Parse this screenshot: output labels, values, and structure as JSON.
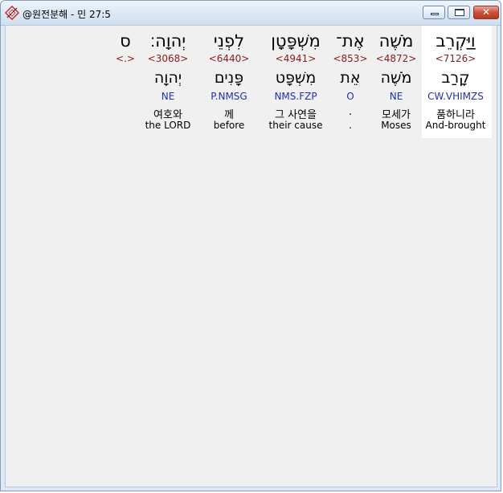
{
  "window": {
    "title": "@원전분해 - 민 27:5"
  },
  "words": [
    {
      "hebrew": "וַיַּקְרֵב",
      "strong": "<7126>",
      "lemma": "קָרַב",
      "morph": "CW.VHIMZS",
      "korean": "품하니라",
      "english": "And-brought"
    },
    {
      "hebrew": "מֹשֶׁה",
      "strong": "<4872>",
      "lemma": "מֹשֶׁה",
      "morph": "NE",
      "korean": "모세가",
      "english": "Moses"
    },
    {
      "hebrew": "אֶת־",
      "strong": "<853>",
      "lemma": "אֵת",
      "morph": "O",
      "korean": ".",
      "english": "."
    },
    {
      "hebrew": "מִשְׁפָּטָן",
      "strong": "<4941>",
      "lemma": "מִשְׁפָּט",
      "morph": "NMS.FZP",
      "korean": "그 사연을",
      "english": "their cause"
    },
    {
      "hebrew": "לִפְנֵי",
      "strong": "<6440>",
      "lemma": "פָּנִים",
      "morph": "P.NMSG",
      "korean": "께",
      "english": "before"
    },
    {
      "hebrew": "יְהוָה׃",
      "strong": "<3068>",
      "lemma": "יְהוָה",
      "morph": "NE",
      "korean": "여호와",
      "english": "the LORD"
    },
    {
      "hebrew": "ס",
      "strong": "<.>",
      "lemma": "",
      "morph": "",
      "korean": "",
      "english": ""
    }
  ],
  "colors": {
    "strong_number": "#8b1a1a",
    "morphology": "#1f2fb3",
    "selected_column_bg": "#ffffff"
  },
  "icons": {
    "app": "app-diamond-icon",
    "minimize": "minimize-icon",
    "maximize": "maximize-icon",
    "close": "close-icon"
  }
}
